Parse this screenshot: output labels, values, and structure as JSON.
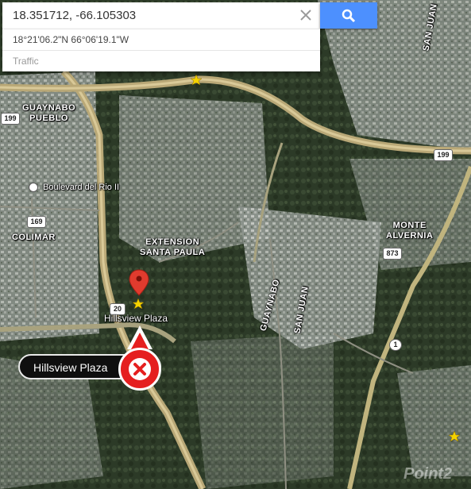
{
  "search": {
    "value": "18.351712, -66.105303",
    "clear_icon": "close-icon",
    "button_icon": "search-icon"
  },
  "suggestions": [
    {
      "label": "18°21'06.2\"N 66°06'19.1\"W"
    },
    {
      "label": "Traffic"
    }
  ],
  "map": {
    "place_labels": [
      {
        "line1": "GUAYNABO",
        "line2": "PUEBLO"
      },
      {
        "line1": "COLIMAR"
      },
      {
        "line1": "EXTENSION",
        "line2": "SANTA PAULA"
      },
      {
        "line1": "MONTE",
        "line2": "ALVERNIA"
      }
    ],
    "street_labels": [
      "GUAYNABO",
      "SAN JUAN",
      "SAN JUAN"
    ],
    "poi": {
      "name": "Boulevard del Rio II",
      "icon": "landmark-icon"
    },
    "route_shields": [
      "199",
      "199",
      "169",
      "20",
      "873",
      "1"
    ],
    "pin_label": "Hillsview Plaza",
    "marker": {
      "label": "Hillsview Plaza",
      "close_icon": "close-icon",
      "color": "#e51f1f"
    }
  },
  "watermark": "Point2"
}
